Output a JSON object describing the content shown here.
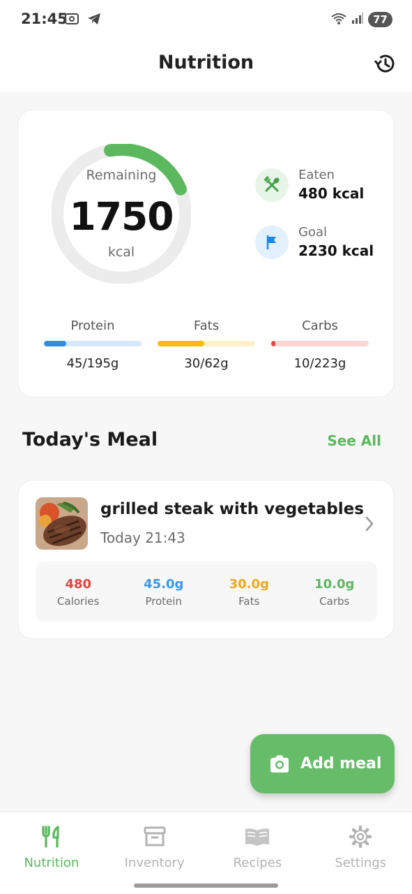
{
  "status_bar": {
    "time": "21:45",
    "battery": "77"
  },
  "header": {
    "title": "Nutrition"
  },
  "summary": {
    "remaining_label": "Remaining",
    "remaining_value": "1750",
    "remaining_unit": "kcal",
    "progress_fraction": 0.215,
    "eaten_label": "Eaten",
    "eaten_value": "480 kcal",
    "goal_label": "Goal",
    "goal_value": "2230 kcal"
  },
  "macros": [
    {
      "name": "Protein",
      "amount": "45/195g",
      "fraction": 0.23,
      "fill_color": "#2e8ee6",
      "track_color": "#d6e9fb"
    },
    {
      "name": "Fats",
      "amount": "30/62g",
      "fraction": 0.48,
      "fill_color": "#f4bd0f",
      "track_color": "#fdf1c9"
    },
    {
      "name": "Carbs",
      "amount": "10/223g",
      "fraction": 0.045,
      "fill_color": "#e0463e",
      "track_color": "#f9d6d4"
    }
  ],
  "today": {
    "title": "Today's Meal",
    "see_all": "See All"
  },
  "meal": {
    "name": "grilled steak with vegetables",
    "time": "Today 21:43",
    "stats": [
      {
        "value": "480",
        "label": "Calories",
        "color": "#e0463e"
      },
      {
        "value": "45.0g",
        "label": "Protein",
        "color": "#3a98e8"
      },
      {
        "value": "30.0g",
        "label": "Fats",
        "color": "#f0a91c"
      },
      {
        "value": "10.0g",
        "label": "Carbs",
        "color": "#5cb85f"
      }
    ]
  },
  "fab": {
    "label": "Add meal"
  },
  "nav": [
    {
      "label": "Nutrition",
      "icon": "fork-knife-icon",
      "active": true
    },
    {
      "label": "Inventory",
      "icon": "archive-box-icon",
      "active": false
    },
    {
      "label": "Recipes",
      "icon": "open-book-icon",
      "active": false
    },
    {
      "label": "Settings",
      "icon": "gear-icon",
      "active": false
    }
  ],
  "colors": {
    "accent": "#5cb85f",
    "fab": "#67bc6a",
    "ring_track": "#ececec"
  }
}
